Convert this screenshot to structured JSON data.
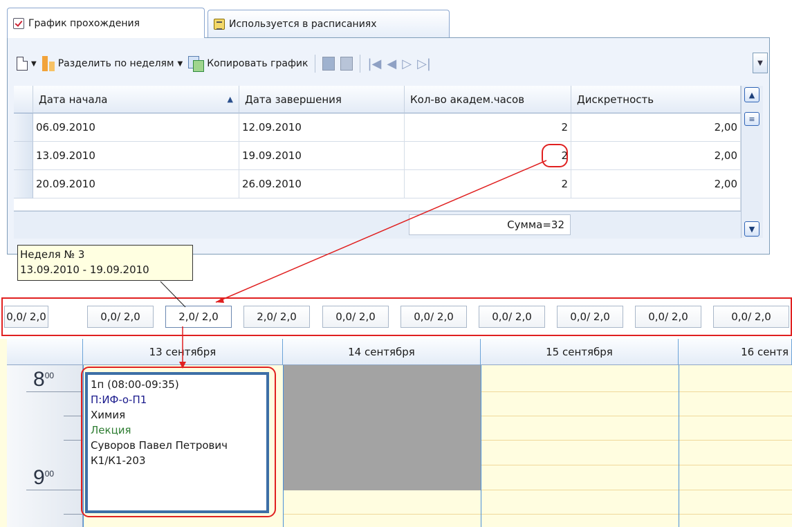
{
  "tabs": [
    {
      "label": "График прохождения",
      "icon": "check-icon"
    },
    {
      "label": "Используется в расписаниях",
      "icon": "list-icon"
    }
  ],
  "toolbar": {
    "split_label": "Разделить по неделям",
    "copy_label": "Копировать график"
  },
  "grid": {
    "columns": [
      "Дата начала",
      "Дата завершения",
      "Кол-во академ.часов",
      "Дискретность"
    ],
    "rows": [
      {
        "start": "06.09.2010",
        "end": "12.09.2010",
        "hours": "2",
        "disc": "2,00"
      },
      {
        "start": "13.09.2010",
        "end": "19.09.2010",
        "hours": "2",
        "disc": "2,00"
      },
      {
        "start": "20.09.2010",
        "end": "26.09.2010",
        "hours": "2",
        "disc": "2,00"
      }
    ],
    "sum": "Сумма=32"
  },
  "tooltip": {
    "line1": "Неделя № 3",
    "line2": "13.09.2010 - 19.09.2010"
  },
  "weeks": [
    "0,0/ 2,0",
    "0,0/ 2,0",
    "2,0/ 2,0",
    "2,0/ 2,0",
    "0,0/ 2,0",
    "0,0/ 2,0",
    "0,0/ 2,0",
    "0,0/ 2,0",
    "0,0/ 2,0",
    "0,0/ 2,0"
  ],
  "calendar": {
    "days": [
      "13 сентября",
      "14 сентября",
      "15 сентября",
      "16 сентя"
    ],
    "hours": [
      "8",
      "9"
    ],
    "hour_suffix": "00",
    "lesson": {
      "time": "1п (08:00-09:35)",
      "group": "П:ИФ-о-П1",
      "subject": "Химия",
      "type": "Лекция",
      "teacher": "Суворов Павел Петрович",
      "room": "К1/К1-203"
    }
  },
  "colors": {
    "highlight": "#e02020",
    "group_text": "#1a1a8c",
    "type_text": "#2e7d32",
    "lesson_border": "#3d6fa6",
    "busy_block": "#a3a3a3",
    "calendar_bg": "#fffde0"
  }
}
